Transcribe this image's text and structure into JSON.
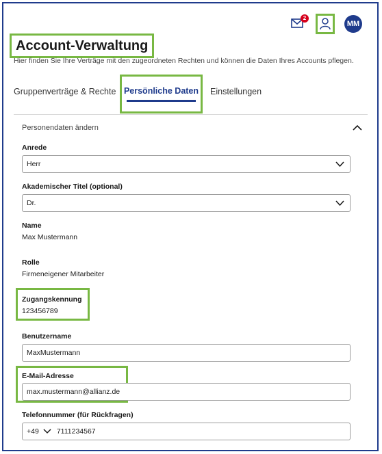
{
  "header": {
    "mail_badge_count": "2",
    "avatar_initials": "MM",
    "icons": {
      "mail": "mail-icon",
      "user": "user-icon"
    }
  },
  "page": {
    "title": "Account-Verwaltung",
    "subtitle": "Hier finden Sie Ihre Verträge mit den zugeordneten Rechten und können die Daten Ihres Accounts pflegen."
  },
  "tabs": [
    {
      "label": "Gruppenverträge & Rechte",
      "active": false
    },
    {
      "label": "Persönliche Daten",
      "active": true
    },
    {
      "label": "Einstellungen",
      "active": false
    }
  ],
  "section": {
    "title": "Personendaten ändern",
    "fields": {
      "anrede": {
        "label": "Anrede",
        "value": "Herr"
      },
      "titel": {
        "label": "Akademischer Titel (optional)",
        "value": "Dr."
      },
      "name": {
        "label": "Name",
        "value": "Max Mustermann"
      },
      "rolle": {
        "label": "Rolle",
        "value": "Firmeneigener Mitarbeiter"
      },
      "kennung": {
        "label": "Zugangskennung",
        "value": "123456789"
      },
      "benutzername": {
        "label": "Benutzername",
        "value": "MaxMustermann"
      },
      "email": {
        "label": "E-Mail-Adresse",
        "value": "max.mustermann@allianz.de"
      },
      "telefon": {
        "label": "Telefonnummer (für Rückfragen)",
        "country_code": "+49",
        "number": "7111234567"
      }
    }
  },
  "colors": {
    "brand": "#1f3b8c",
    "highlight": "#78b843",
    "badge": "#d6001c"
  }
}
